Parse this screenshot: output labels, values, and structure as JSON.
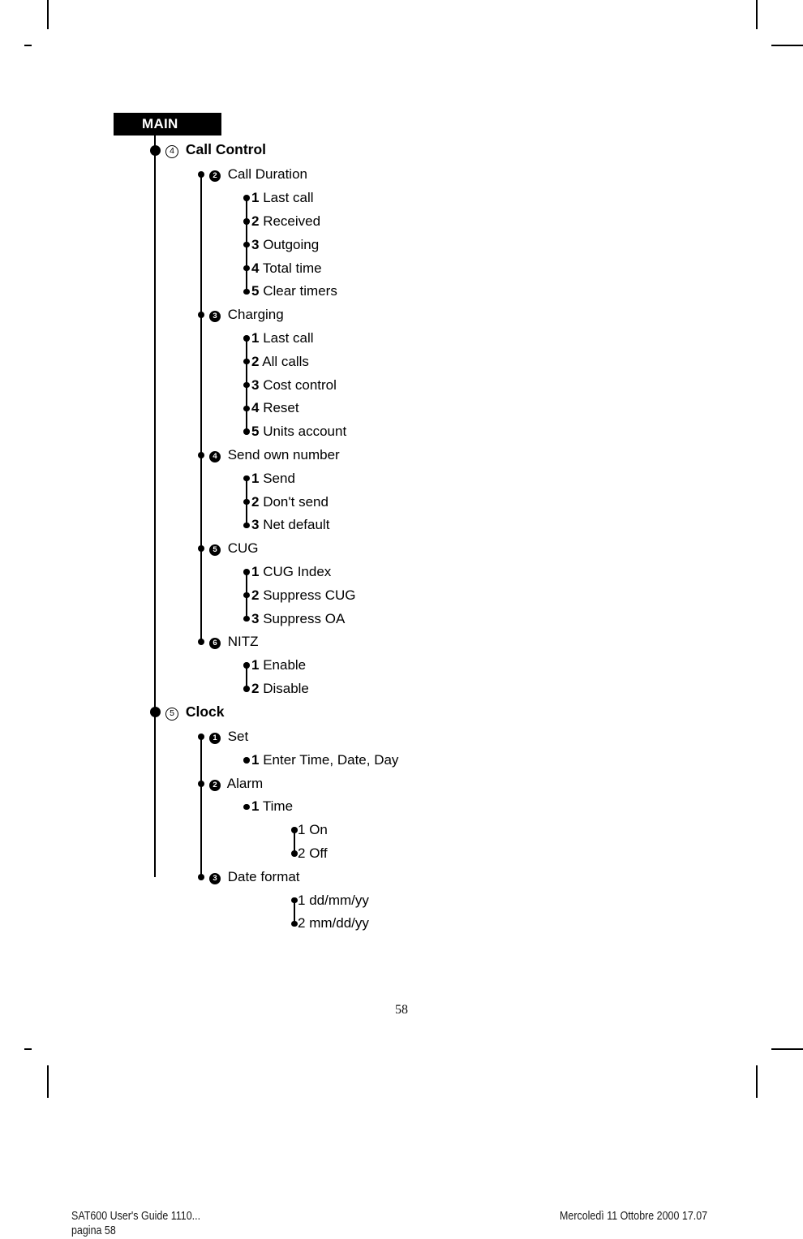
{
  "page": {
    "number": "58",
    "root_label": "MAIN"
  },
  "footer": {
    "doc_title": "SAT600 User's Guide 1110...",
    "doc_page": "pagina 58",
    "timestamp": "Mercoledì 11 Ottobre 2000 17.07"
  },
  "tree": {
    "sections": [
      {
        "marker": "4",
        "marker_style": "ring",
        "label": "Call Control",
        "groups": [
          {
            "marker": "2",
            "marker_style": "disc",
            "label": "Call Duration",
            "items": [
              {
                "num": "1",
                "label": "Last call"
              },
              {
                "num": "2",
                "label": "Received"
              },
              {
                "num": "3",
                "label": "Outgoing"
              },
              {
                "num": "4",
                "label": "Total time"
              },
              {
                "num": "5",
                "label": "Clear timers"
              }
            ]
          },
          {
            "marker": "3",
            "marker_style": "disc",
            "label": "Charging",
            "items": [
              {
                "num": "1",
                "label": "Last call"
              },
              {
                "num": "2",
                "label": "All calls"
              },
              {
                "num": "3",
                "label": "Cost control"
              },
              {
                "num": "4",
                "label": "Reset"
              },
              {
                "num": "5",
                "label": "Units account"
              }
            ]
          },
          {
            "marker": "4",
            "marker_style": "disc",
            "label": "Send own number",
            "items": [
              {
                "num": "1",
                "label": "Send"
              },
              {
                "num": "2",
                "label": "Don't send"
              },
              {
                "num": "3",
                "label": "Net default"
              }
            ]
          },
          {
            "marker": "5",
            "marker_style": "disc",
            "label": "CUG",
            "items": [
              {
                "num": "1",
                "label": "CUG Index"
              },
              {
                "num": "2",
                "label": "Suppress CUG"
              },
              {
                "num": "3",
                "label": "Suppress OA"
              }
            ]
          },
          {
            "marker": "6",
            "marker_style": "disc",
            "label": "NITZ",
            "items": [
              {
                "num": "1",
                "label": "Enable"
              },
              {
                "num": "2",
                "label": "Disable"
              }
            ]
          }
        ]
      },
      {
        "marker": "5",
        "marker_style": "ring",
        "label": "Clock",
        "groups": [
          {
            "marker": "1",
            "marker_style": "disc",
            "label": "Set",
            "items": [
              {
                "num": "1",
                "label": "Enter Time, Date, Day"
              }
            ]
          },
          {
            "marker": "2",
            "marker_style": "disc",
            "label": "Alarm",
            "items": [
              {
                "num": "1",
                "label": "Time",
                "subitems": [
                  {
                    "num": "1",
                    "label": "On"
                  },
                  {
                    "num": "2",
                    "label": "Off"
                  }
                ]
              }
            ]
          },
          {
            "marker": "3",
            "marker_style": "disc",
            "label": "Date format",
            "items": [
              {
                "num": "",
                "label": "",
                "subitems": [
                  {
                    "num": "1",
                    "label": "dd/mm/yy"
                  },
                  {
                    "num": "2",
                    "label": "mm/dd/yy"
                  }
                ]
              }
            ]
          }
        ]
      }
    ]
  }
}
